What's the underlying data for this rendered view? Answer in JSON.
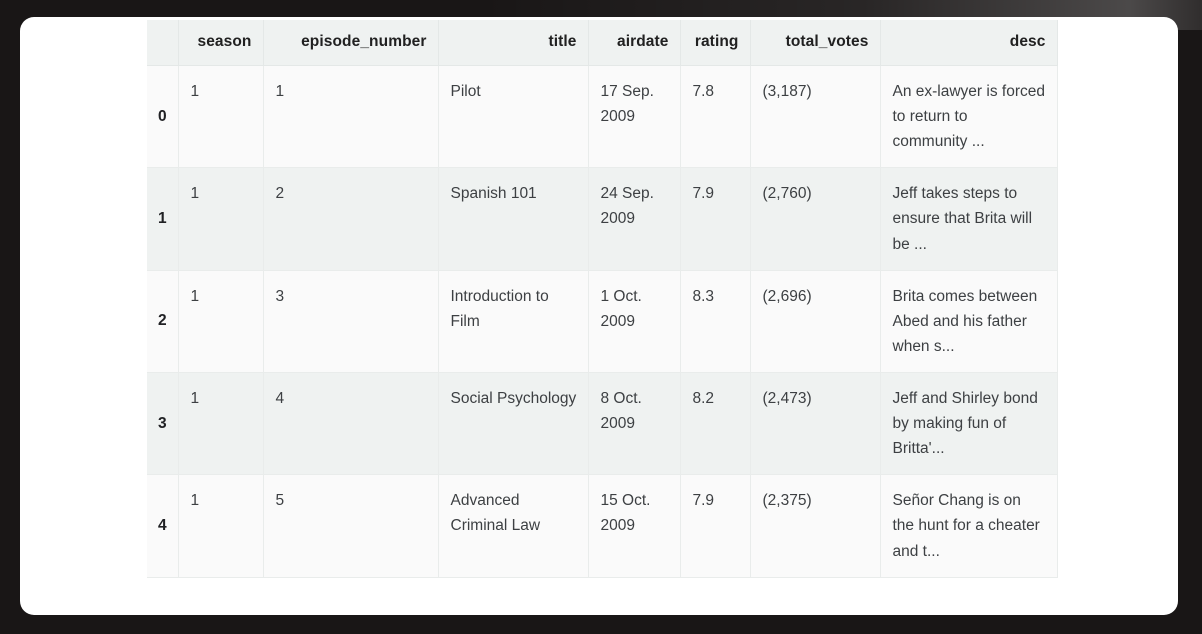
{
  "table": {
    "index_header": "",
    "columns": [
      {
        "key": "season",
        "label": "season"
      },
      {
        "key": "episode_number",
        "label": "episode_number"
      },
      {
        "key": "title",
        "label": "title"
      },
      {
        "key": "airdate",
        "label": "airdate"
      },
      {
        "key": "rating",
        "label": "rating"
      },
      {
        "key": "total_votes",
        "label": "total_votes"
      },
      {
        "key": "desc",
        "label": "desc"
      }
    ],
    "rows": [
      {
        "index": "0",
        "season": "1",
        "episode_number": "1",
        "title": "Pilot",
        "airdate": "17 Sep. 2009",
        "rating": "7.8",
        "total_votes": "(3,187)",
        "desc": "An ex-lawyer is forced to return to community ..."
      },
      {
        "index": "1",
        "season": "1",
        "episode_number": "2",
        "title": "Spanish 101",
        "airdate": "24 Sep. 2009",
        "rating": "7.9",
        "total_votes": "(2,760)",
        "desc": "Jeff takes steps to ensure that Brita will be ..."
      },
      {
        "index": "2",
        "season": "1",
        "episode_number": "3",
        "title": "Introduction to Film",
        "airdate": "1 Oct. 2009",
        "rating": "8.3",
        "total_votes": "(2,696)",
        "desc": "Brita comes between Abed and his father when s..."
      },
      {
        "index": "3",
        "season": "1",
        "episode_number": "4",
        "title": "Social Psychology",
        "airdate": "8 Oct. 2009",
        "rating": "8.2",
        "total_votes": "(2,473)",
        "desc": "Jeff and Shirley bond by making fun of Britta'..."
      },
      {
        "index": "4",
        "season": "1",
        "episode_number": "5",
        "title": "Advanced Criminal Law",
        "airdate": "15 Oct. 2009",
        "rating": "7.9",
        "total_votes": "(2,375)",
        "desc": "Señor Chang is on the hunt for a cheater and t..."
      }
    ]
  },
  "colors": {
    "backdrop": "#191616",
    "card": "#ffffff",
    "header_bg": "#eff2f1",
    "row_even_bg": "#fafafa",
    "row_odd_bg": "#eff2f1",
    "grid_line": "#e9eceb",
    "text": "#3d4043",
    "header_text": "#212121"
  }
}
